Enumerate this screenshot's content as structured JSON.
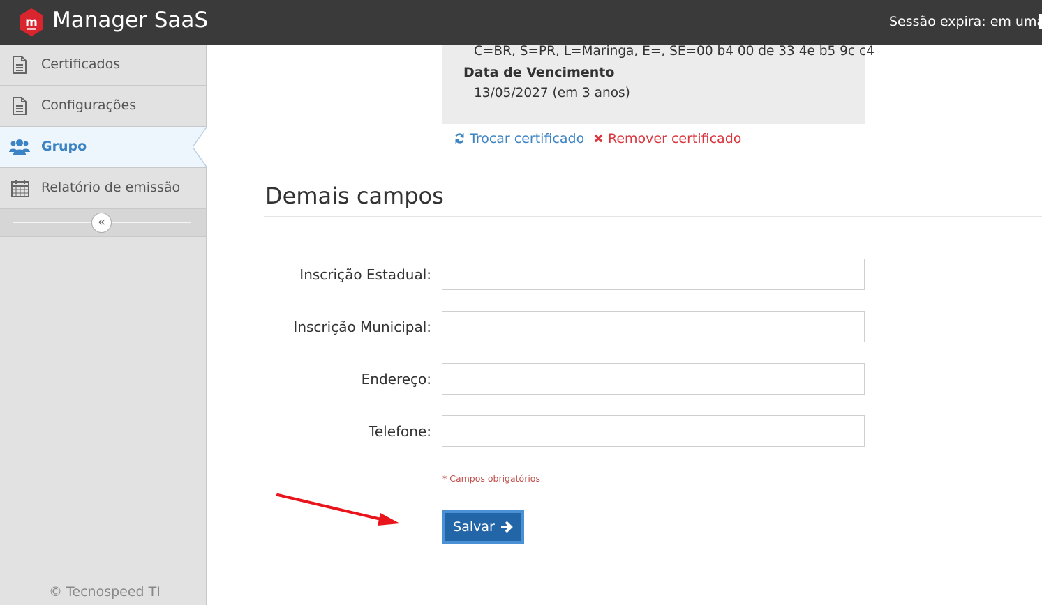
{
  "app": {
    "title": "Manager SaaS",
    "session_text": "Sessão expira: em uma h"
  },
  "sidebar": {
    "items": [
      {
        "label": "Certificados",
        "icon": "document-icon",
        "active": false
      },
      {
        "label": "Configurações",
        "icon": "document-icon",
        "active": false
      },
      {
        "label": "Grupo",
        "icon": "users-icon",
        "active": true
      },
      {
        "label": "Relatório de emissão",
        "icon": "calendar-icon",
        "active": false
      }
    ],
    "collapse_glyph": "«",
    "copyright": "© Tecnospeed TI"
  },
  "certificate": {
    "subject": "C=BR, S=PR, L=Maringa, E=, SE=00 b4 00 de 33 4e b5 9c c4",
    "expiry_label": "Data de Vencimento",
    "expiry_value": "13/05/2027 (em 3 anos)",
    "swap_label": "Trocar certificado",
    "remove_label": "Remover certificado"
  },
  "form": {
    "section_title": "Demais campos",
    "fields": [
      {
        "label": "Inscrição Estadual:",
        "value": ""
      },
      {
        "label": "Inscrição Municipal:",
        "value": ""
      },
      {
        "label": "Endereço:",
        "value": ""
      },
      {
        "label": "Telefone:",
        "value": ""
      }
    ],
    "required_note": "* Campos obrigatórios",
    "save_label": "Salvar"
  },
  "colors": {
    "topbar": "#3a3a3a",
    "brand_red": "#d9262e",
    "accent_blue": "#3c83c4",
    "button_blue": "#2366a8",
    "danger_red": "#d9363e",
    "annotation_red": "#e8161c"
  }
}
